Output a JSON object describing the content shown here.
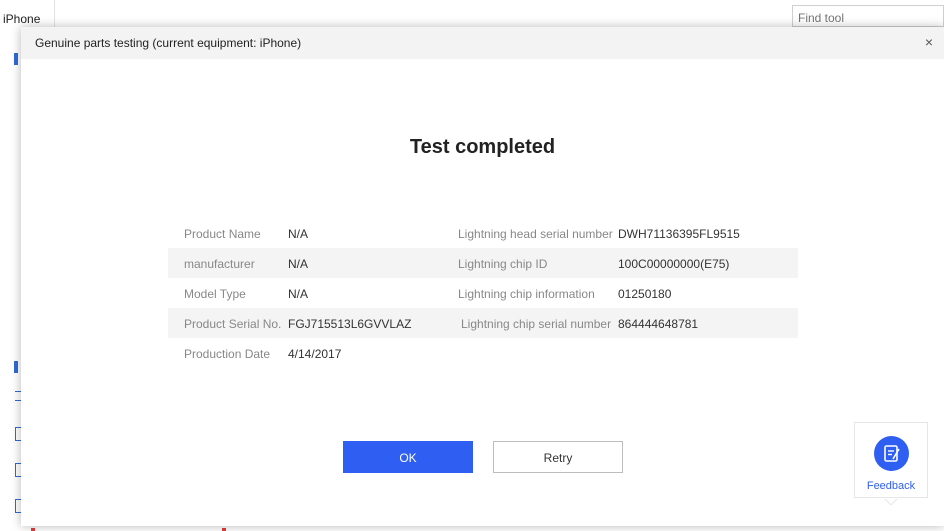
{
  "background": {
    "tab_label": "iPhone",
    "search_placeholder": "Find tool"
  },
  "dialog": {
    "title": "Genuine parts testing (current equipment: iPhone)",
    "close_symbol": "×",
    "result_heading": "Test completed",
    "rows": [
      {
        "label1": "Product Name",
        "value1": "N/A",
        "label2": "Lightning head serial number",
        "value2": "DWH71136395FL9515"
      },
      {
        "label1": "manufacturer",
        "value1": "N/A",
        "label2": "Lightning chip ID",
        "value2": "100C00000000(E75)"
      },
      {
        "label1": "Model Type",
        "value1": "N/A",
        "label2": "Lightning chip information",
        "value2": "01250180"
      },
      {
        "label1": "Product Serial No.",
        "value1": "FGJ715513L6GVVLAZ",
        "label2": "Lightning chip serial number",
        "value2": "864444648781"
      },
      {
        "label1": "Production Date",
        "value1": "4/14/2017",
        "label2": "",
        "value2": ""
      }
    ],
    "ok_label": "OK",
    "retry_label": "Retry"
  },
  "feedback": {
    "label": "Feedback",
    "icon": "feedback-edit-icon"
  },
  "colors": {
    "accent": "#2f5ef2",
    "header_bg": "#f3f3f3",
    "row_shade": "#f4f4f4",
    "label_text": "#888888"
  }
}
